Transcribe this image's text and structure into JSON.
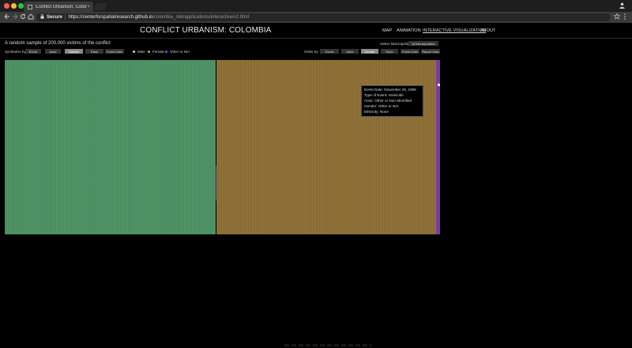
{
  "browser": {
    "tab_title": "Conflict Urbanism: Colombia",
    "tab_close": "×",
    "url_secure_label": "Secure",
    "url_host": "https://centerforspatialresearch.github.io",
    "url_path": "/colombia_site/applications/interactive/v2.html",
    "icons": {
      "back": "arrow-left-icon",
      "forward": "arrow-right-icon",
      "reload": "reload-icon",
      "home": "home-icon",
      "lock": "lock-icon",
      "star": "star-icon",
      "menu": "kebab-menu-icon",
      "user": "user-icon"
    },
    "colors": {
      "close": "#ff5f57",
      "minimize": "#febc2e",
      "maximize": "#28c840"
    }
  },
  "site": {
    "title": "CONFLICT URBANISM: COLOMBIA",
    "nav": [
      "MAP",
      "ANIMATION",
      "INTERACTIVE VISUALIZATION",
      "ABOUT"
    ],
    "nav_active_index": 2
  },
  "controls": {
    "subtitle": "A random sample of 200,000 victims of the conflict",
    "select_municipality_label": "Select Municipality",
    "municipality_value": "All Municipalities",
    "symbolize_by_label": "Symbolize by:",
    "symbolize_options": [
      "Event",
      "Actor",
      "Gender",
      "Race",
      "Event Date"
    ],
    "symbolize_active_index": 2,
    "legend": [
      {
        "label": "Male",
        "color": "#e8e040"
      },
      {
        "label": "Female",
        "color": "#d8a040"
      },
      {
        "label": "Other or N/A",
        "color": "#8a4fc0"
      }
    ],
    "order_by_label": "Order by:",
    "order_options": [
      "Event",
      "Actor",
      "Gender",
      "Race",
      "Event Date",
      "Report Date"
    ],
    "order_active_index": 2
  },
  "visualization": {
    "segments": [
      {
        "name": "Male",
        "color": "#519868"
      },
      {
        "name": "Female",
        "color": "#97773a"
      },
      {
        "name": "Other or N/A",
        "color": "#7b3ca0"
      }
    ],
    "tooltip": [
      "Event Date: November 28, 1999",
      "Type of Event: Homicide",
      "Actor: Other or Non-Identified",
      "Gender: Other or N/A",
      "Ethnicity: None"
    ]
  }
}
